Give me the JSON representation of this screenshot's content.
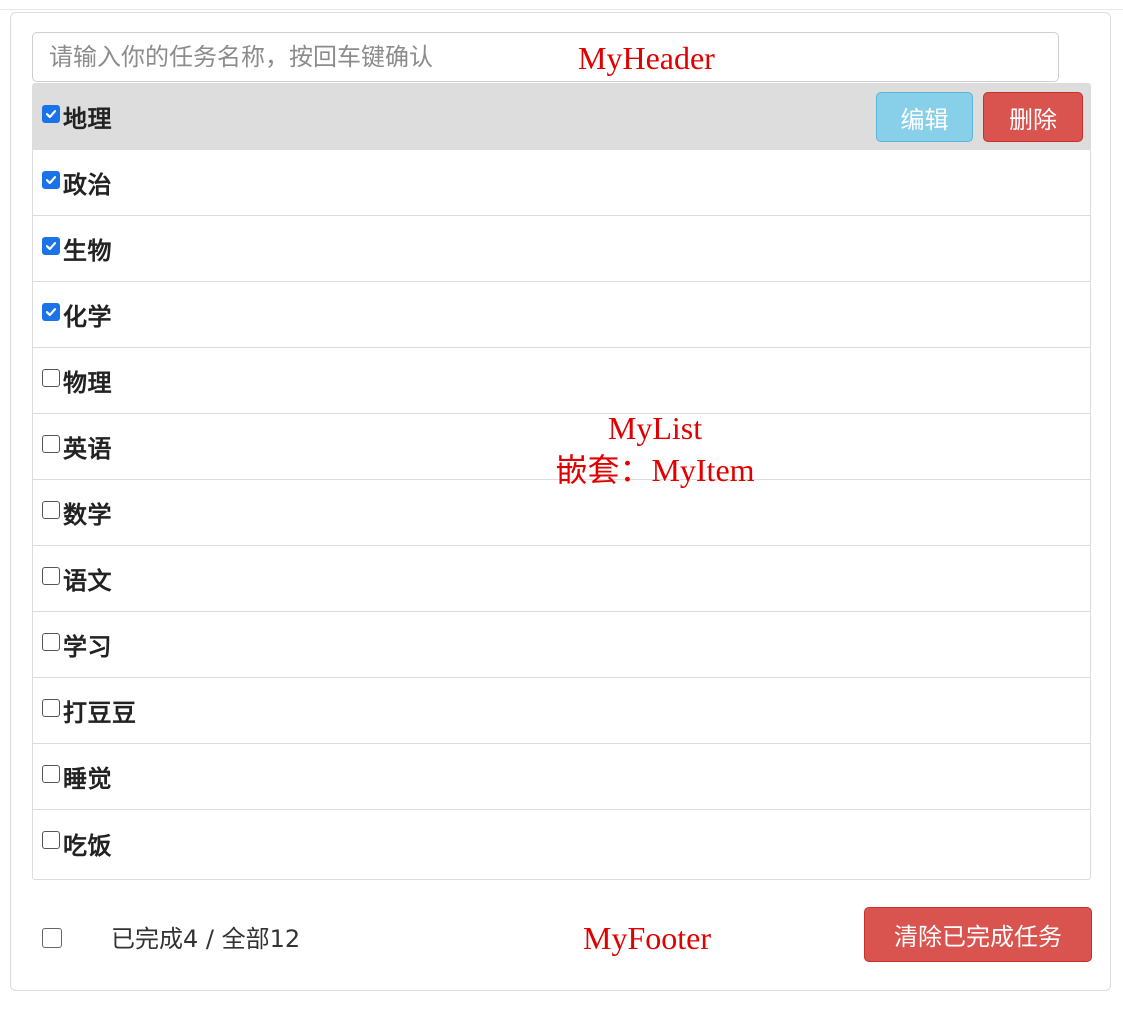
{
  "header": {
    "input_placeholder": "请输入你的任务名称，按回车键确认",
    "input_value": ""
  },
  "list": {
    "items": [
      {
        "label": "地理",
        "done": true,
        "hover": true
      },
      {
        "label": "政治",
        "done": true
      },
      {
        "label": "生物",
        "done": true
      },
      {
        "label": "化学",
        "done": true
      },
      {
        "label": "物理",
        "done": false
      },
      {
        "label": "英语",
        "done": false
      },
      {
        "label": "数学",
        "done": false
      },
      {
        "label": "语文",
        "done": false
      },
      {
        "label": "学习",
        "done": false
      },
      {
        "label": "打豆豆",
        "done": false
      },
      {
        "label": "睡觉",
        "done": false
      },
      {
        "label": "吃饭",
        "done": false
      }
    ],
    "edit_label": "编辑",
    "delete_label": "删除"
  },
  "footer": {
    "select_all_checked": false,
    "status_text": "已完成4 / 全部12",
    "clear_button_label": "清除已完成任务"
  },
  "annotations": {
    "header": "MyHeader",
    "list_line1": "MyList",
    "list_line2": "嵌套：MyItem",
    "footer": "MyFooter"
  },
  "colors": {
    "accent_checkbox": "#1a73e8",
    "edit_button": "#88cfe9",
    "danger_button": "#d9534f",
    "hover_row": "#dddddd",
    "annotation_text": "#e00000"
  }
}
